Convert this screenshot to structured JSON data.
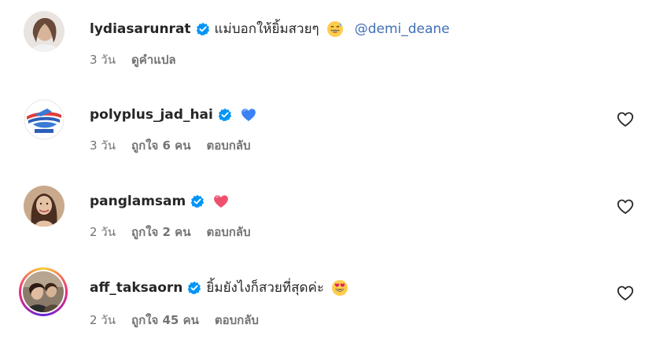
{
  "comments": [
    {
      "username": "lydiasarunrat",
      "text": "แม่บอกให้ยิ้มสวยๆ",
      "emoji_icon": "grinning-sweat-emoji",
      "mention": "@demi_deane",
      "time": "3 วัน",
      "translate": "ดูคำแปล"
    },
    {
      "username": "polyplus_jad_hai",
      "text": "",
      "emoji_icon": "blue-heart-emoji",
      "time": "3 วัน",
      "likes": "ถูกใจ 6 คน",
      "reply": "ตอบกลับ"
    },
    {
      "username": "panglamsam",
      "text": "",
      "emoji_icon": "red-heart-emoji",
      "time": "2 วัน",
      "likes": "ถูกใจ 2 คน",
      "reply": "ตอบกลับ"
    },
    {
      "username": "aff_taksaorn",
      "text": "ยิ้มยังไงก็สวยที่สุดค่ะ",
      "emoji_icon": "heart-eyes-emoji",
      "time": "2 วัน",
      "likes": "ถูกใจ 45 คน",
      "reply": "ตอบกลับ"
    }
  ],
  "colors": {
    "verified": "#0095f6",
    "mention": "#3f6fb5",
    "meta": "#737373",
    "text": "#262626"
  }
}
